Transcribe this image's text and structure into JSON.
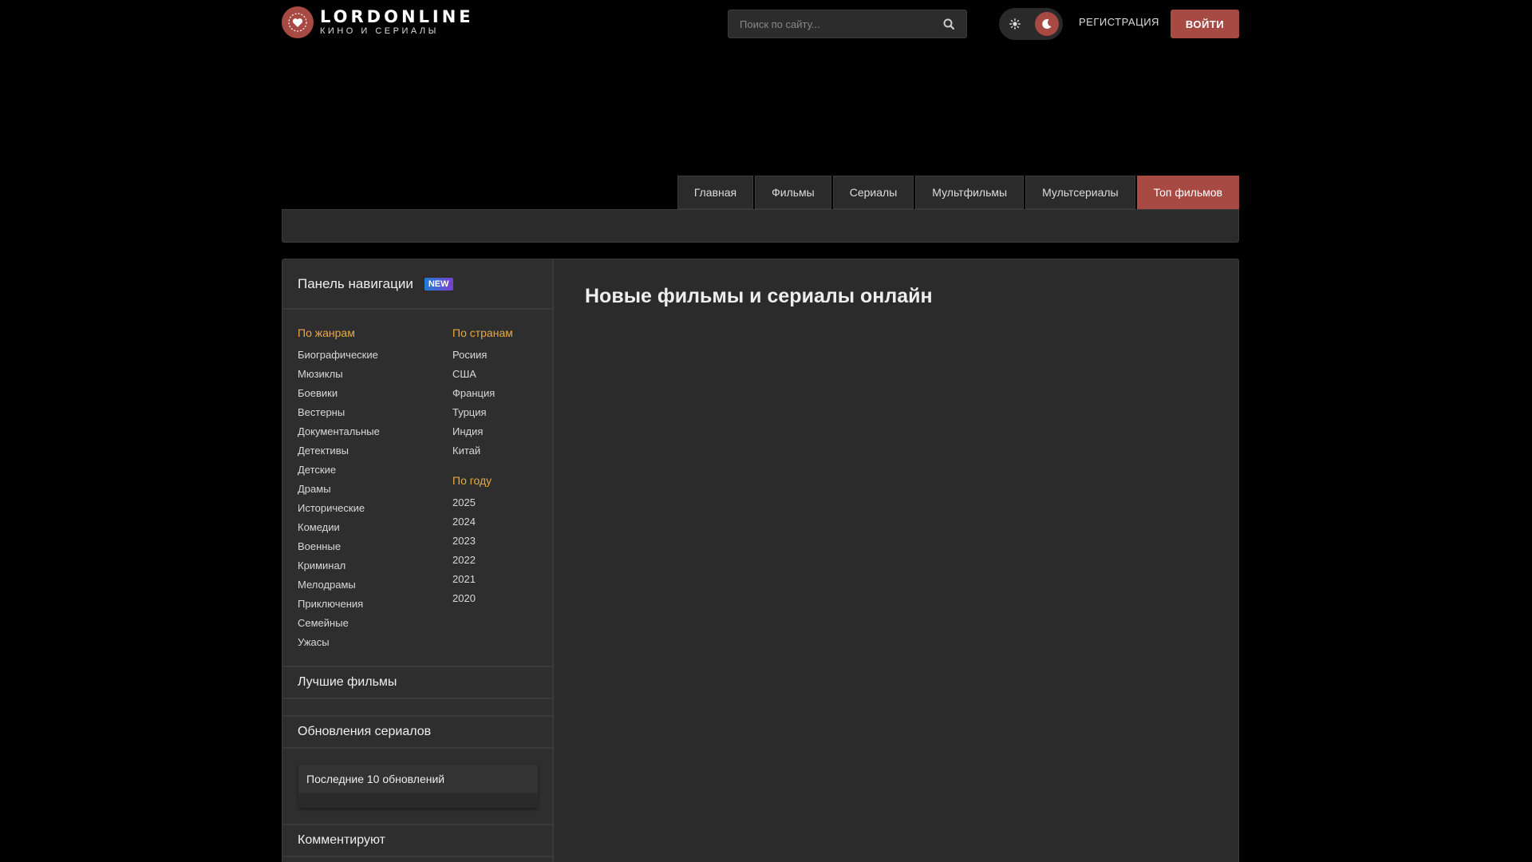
{
  "header": {
    "logo_title": "LORDONLINE",
    "logo_sub": "КИНО И СЕРИАЛЫ",
    "search_placeholder": "Поиск по сайту...",
    "register_label": "РЕГИСТРАЦИЯ",
    "login_label": "ВОЙТИ"
  },
  "nav": {
    "tabs": [
      {
        "label": "Главная"
      },
      {
        "label": "Фильмы"
      },
      {
        "label": "Сериалы"
      },
      {
        "label": "Мультфильмы"
      },
      {
        "label": "Мультсериалы"
      },
      {
        "label": "Топ фильмов"
      }
    ]
  },
  "sidebar": {
    "panel_title": "Панель навигации",
    "panel_badge": "NEW",
    "genres_title": "По жанрам",
    "genres": [
      "Биографические",
      "Мюзиклы",
      "Боевики",
      "Вестерны",
      "Документальные",
      "Детективы",
      "Детские",
      "Драмы",
      "Исторические",
      "Комедии",
      "Военные",
      "Криминал",
      "Мелодрамы",
      "Приключения",
      "Семейные",
      "Ужасы"
    ],
    "countries_title": "По странам",
    "countries": [
      "Росиия",
      "США",
      "Франция",
      "Турция",
      "Индия",
      "Китай"
    ],
    "years_title": "По году",
    "years": [
      "2025",
      "2024",
      "2023",
      "2022",
      "2021",
      "2020"
    ],
    "best_title": "Лучшие фильмы",
    "updates_title": "Обновления сериалов",
    "updates_box_title": "Последние 10 обновлений",
    "comments_title": "Комментируют"
  },
  "main": {
    "title": "Новые фильмы и сериалы онлайн"
  },
  "colors": {
    "accent": "#a84a44",
    "section_title": "#e8a93c",
    "background": "#000000",
    "panel": "#2b2b2b"
  }
}
